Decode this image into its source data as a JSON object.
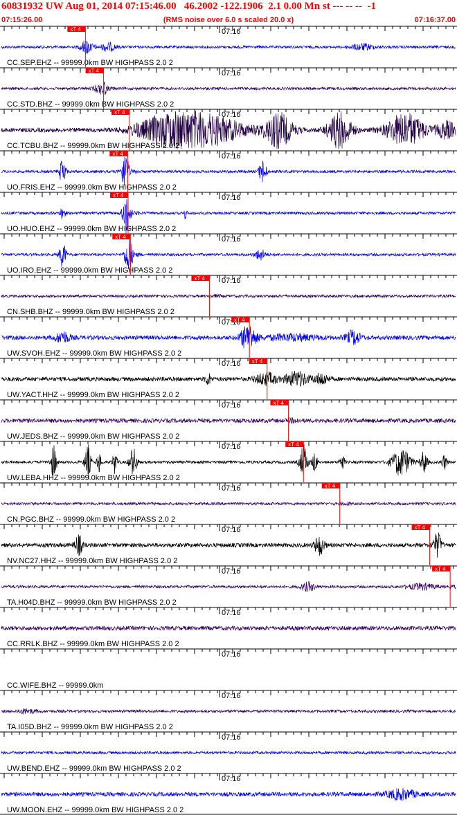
{
  "header": {
    "title": "60831932 UW Aug 01, 2014 07:15:46.00   46.2002 -122.1906  2.1 0.00 Mn st --- -- --  -1",
    "start_time": "07:15:26.00",
    "note": "(RMS noise over 6.0 s scaled 20.0 x)",
    "end_time": "07:16:37.00"
  },
  "chart_data": {
    "type": "line",
    "title": "60831932 UW Aug 01, 2014 07:15:46.00   46.2002 -122.1906  2.1 0.00 Mn st --- -- --  -1",
    "x_start": "07:15:26.00",
    "x_end": "07:16:37.00",
    "minute_label": "07:16",
    "pick_label": "xT 4",
    "colors": {
      "header": "#ff0000",
      "pick": "#ff0000",
      "blue": "#0000ff",
      "purple": "#330066",
      "dark": "#220044",
      "black": "#000000"
    },
    "traces": [
      {
        "label": "CC.SEP.EHZ -- 99999.0km BW  HIGHPASS  2.0  2",
        "color": "#0000ff",
        "noise": 2,
        "pick": 18.5,
        "bursts": [
          [
            18.7,
            1.2,
            9
          ],
          [
            23.5,
            1.5,
            6
          ],
          [
            79.5,
            2.5,
            4
          ]
        ]
      },
      {
        "label": "CC.STD.BHZ -- 99999.0km BW  HIGHPASS  2.0  2",
        "color": "#330066",
        "noise": 2,
        "pick": 22.5,
        "bursts": [
          [
            22.5,
            0.6,
            8
          ],
          [
            21.5,
            1.2,
            5
          ]
        ]
      },
      {
        "label": "CC.TCBU.BHZ -- 99999.0km BW  HIGHPASS  2.0  2",
        "color": "#220044",
        "noise": 3,
        "pick": 28.2,
        "bursts": [
          [
            36,
            6,
            18
          ],
          [
            45,
            8,
            22
          ],
          [
            61,
            3,
            24
          ],
          [
            74.5,
            2.5,
            26
          ],
          [
            89,
            4,
            24
          ],
          [
            98,
            2,
            12
          ]
        ]
      },
      {
        "label": "UO.FRIS.EHZ -- 99999.0km BW  HIGHPASS  2.0  2",
        "color": "#0000ff",
        "noise": 2,
        "pick": 27.8,
        "bursts": [
          [
            13.5,
            0.6,
            22
          ],
          [
            27.2,
            0.8,
            26
          ],
          [
            57.5,
            0.8,
            16
          ]
        ]
      },
      {
        "label": "UO.HUO.EHZ -- 99999.0km BW  HIGHPASS  2.0  2",
        "color": "#0000ff",
        "noise": 2,
        "pick": 27.9,
        "bursts": [
          [
            13.5,
            0.5,
            10
          ],
          [
            27.5,
            0.8,
            28
          ],
          [
            40.5,
            0.3,
            8
          ]
        ]
      },
      {
        "label": "UO.IRO.EHZ -- 99999.0km BW  HIGHPASS  2.0  2",
        "color": "#0000ff",
        "noise": 2,
        "pick": 28.4,
        "bursts": [
          [
            13.5,
            0.7,
            18
          ],
          [
            28,
            0.8,
            28
          ],
          [
            57,
            1,
            8
          ]
        ]
      },
      {
        "label": "CN.SHB.BHZ -- 99999.0km BW  HIGHPASS  2.0  2",
        "color": "#330066",
        "noise": 2,
        "pick": 45.8,
        "bursts": []
      },
      {
        "label": "UW.SVOH.EHZ -- 99999.0km BW  HIGHPASS  2.0  2",
        "color": "#0000ff",
        "noise": 3,
        "pick": 54.6,
        "bursts": [
          [
            13.5,
            1.5,
            8
          ],
          [
            54.2,
            1.5,
            18
          ],
          [
            77.5,
            1.5,
            10
          ],
          [
            64,
            6,
            4
          ]
        ]
      },
      {
        "label": "UW.YACT.HHZ -- 99999.0km BW  HIGHPASS  2.0  2",
        "color": "#000000",
        "noise": 3,
        "pick": 58.5,
        "bursts": [
          [
            45.5,
            0.6,
            8
          ],
          [
            58,
            2,
            8
          ],
          [
            65,
            2.5,
            10
          ],
          [
            70.5,
            1.5,
            8
          ]
        ]
      },
      {
        "label": "UW.JEDS.BHZ -- 99999.0km BW  HIGHPASS  2.0  2",
        "color": "#330066",
        "noise": 3,
        "pick": 63.2,
        "bursts": []
      },
      {
        "label": "UW.LEBA.HHZ -- 99999.0km BW  HIGHPASS  2.0  2",
        "color": "#000000",
        "noise": 2,
        "pick": 66.5,
        "bursts": [
          [
            11.5,
            0.6,
            24
          ],
          [
            19,
            0.6,
            26
          ],
          [
            21.5,
            0.5,
            14
          ],
          [
            25,
            0.5,
            16
          ],
          [
            29,
            0.8,
            20
          ],
          [
            66.5,
            0.8,
            24
          ],
          [
            69,
            0.5,
            14
          ],
          [
            75,
            0.5,
            12
          ],
          [
            88,
            2,
            20
          ],
          [
            93,
            0.7,
            16
          ],
          [
            97.5,
            0.6,
            10
          ]
        ]
      },
      {
        "label": "CN.PGC.BHZ -- 99999.0km BW  HIGHPASS  2.0  2",
        "color": "#330066",
        "noise": 2,
        "pick": 74.5,
        "bursts": []
      },
      {
        "label": "NV.NC27.HHZ -- 99999.0km BW  HIGHPASS  2.0  2",
        "color": "#000000",
        "noise": 3,
        "pick": 94.3,
        "bursts": [
          [
            17,
            0.8,
            14
          ],
          [
            70,
            1,
            14
          ],
          [
            96,
            0.8,
            16
          ]
        ]
      },
      {
        "label": "TA.H04D.BHZ -- 99999.0km BW  HIGHPASS  2.0  2",
        "color": "#330066",
        "noise": 2,
        "pick": 98.8,
        "bursts": [
          [
            67.5,
            1.5,
            6
          ],
          [
            92.5,
            3,
            4
          ]
        ]
      },
      {
        "label": "CC.RRLK.BHZ -- 99999.0km BW  HIGHPASS  2.0  2",
        "color": "#330066",
        "noise": 3,
        "pick": null,
        "bursts": []
      },
      {
        "label": "CC.WIFE.BHZ -- 99999.0km",
        "color": "#330066",
        "noise": 0,
        "pick": null,
        "bursts": []
      },
      {
        "label": "TA.I05D.BHZ -- 99999.0km BW  HIGHPASS  2.0  2",
        "color": "#330066",
        "noise": 2,
        "pick": null,
        "bursts": [
          [
            5.5,
            2,
            3
          ]
        ]
      },
      {
        "label": "UW.BEND.EHZ -- 99999.0km BW  HIGHPASS  2.0  2",
        "color": "#0000ff",
        "noise": 2,
        "pick": null,
        "bursts": []
      },
      {
        "label": "UW.MOON.EHZ -- 99999.0km BW  HIGHPASS  2.0  2",
        "color": "#0000ff",
        "noise": 3,
        "pick": null,
        "bursts": [
          [
            88,
            3,
            7
          ]
        ]
      }
    ]
  }
}
